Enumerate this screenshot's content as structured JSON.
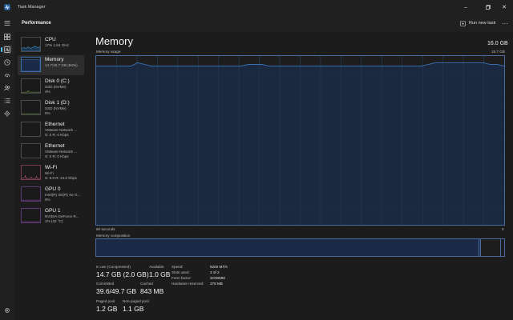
{
  "window": {
    "title": "Task Manager"
  },
  "header": {
    "title": "Performance",
    "run_task_label": "Run new task",
    "more_label": "···"
  },
  "colors": {
    "accent": "#4cc2ff",
    "memory_line": "#3a6fb0",
    "memory_fill": "#1b2b47",
    "wifi": "#c25a86",
    "gpu": "#9a4fbf",
    "cpu": "#4a9fd0",
    "disk": "#7aa84a"
  },
  "perf_items": [
    {
      "name": "CPU",
      "sub1": "17%  1.84 GHz",
      "sub2": ""
    },
    {
      "name": "Memory",
      "sub1": "14.7/15.7 GB (94%)",
      "sub2": ""
    },
    {
      "name": "Disk 0 (C:)",
      "sub1": "SSD (NVMe)",
      "sub2": "4%"
    },
    {
      "name": "Disk 1 (D:)",
      "sub1": "SSD (NVMe)",
      "sub2": "0%"
    },
    {
      "name": "Ethernet",
      "sub1": "VMware Network ...",
      "sub2": "S: 0  R: 0 Kbps"
    },
    {
      "name": "Ethernet",
      "sub1": "VMware Network ...",
      "sub2": "S: 0  R: 0 Kbps"
    },
    {
      "name": "Wi-Fi",
      "sub1": "Wi-Fi",
      "sub2": "S: 8.0  R: 24.0 Kbps"
    },
    {
      "name": "GPU 0",
      "sub1": "Intel(R) Iris(R) Xe G...",
      "sub2": "0%"
    },
    {
      "name": "GPU 1",
      "sub1": "NVIDIA GeForce R...",
      "sub2": "1% (42 °C)"
    }
  ],
  "main": {
    "title": "Memory",
    "total": "16.0 GB",
    "usage_label": "Memory usage",
    "usage_max": "15.7 GB",
    "axis_left": "60 seconds",
    "axis_right": "0",
    "composition_label": "Memory composition",
    "usage_series": [
      0.94,
      0.94,
      0.94,
      0.94,
      0.94,
      0.94,
      0.96,
      0.95,
      0.94,
      0.94,
      0.94,
      0.94,
      0.94,
      0.94,
      0.94,
      0.94,
      0.94,
      0.94,
      0.94,
      0.94,
      0.94,
      0.94,
      0.95,
      0.95,
      0.95,
      0.94,
      0.94,
      0.94,
      0.94,
      0.94,
      0.94,
      0.94,
      0.94,
      0.94,
      0.94,
      0.94,
      0.94,
      0.94,
      0.94,
      0.94,
      0.94,
      0.94,
      0.94,
      0.94,
      0.94,
      0.94,
      0.94,
      0.94,
      0.95,
      0.96,
      0.96,
      0.96,
      0.96,
      0.96,
      0.96,
      0.96,
      0.96,
      0.95,
      0.95,
      0.94
    ],
    "composition": {
      "in_use_fraction": 0.938,
      "modified_fraction": 0.004,
      "standby_fraction": 0.05,
      "free_fraction": 0.008
    }
  },
  "stats": {
    "in_use_label": "In use (Compressed)",
    "in_use_value": "14.7 GB (2.0 GB)",
    "available_label": "Available",
    "available_value": "1.0 GB",
    "committed_label": "Committed",
    "committed_value": "39.6/49.7 GB",
    "cached_label": "Cached",
    "cached_value": "843 MB",
    "paged_label": "Paged pool",
    "paged_value": "1.2 GB",
    "nonpaged_label": "Non-paged pool",
    "nonpaged_value": "1.1 GB"
  },
  "details": {
    "speed_label": "Speed:",
    "speed_value": "5200 MT/s",
    "slots_label": "Slots used:",
    "slots_value": "2 of 2",
    "form_label": "Form factor:",
    "form_value": "SODIMM",
    "hw_label": "Hardware reserved:",
    "hw_value": "278 MB"
  }
}
